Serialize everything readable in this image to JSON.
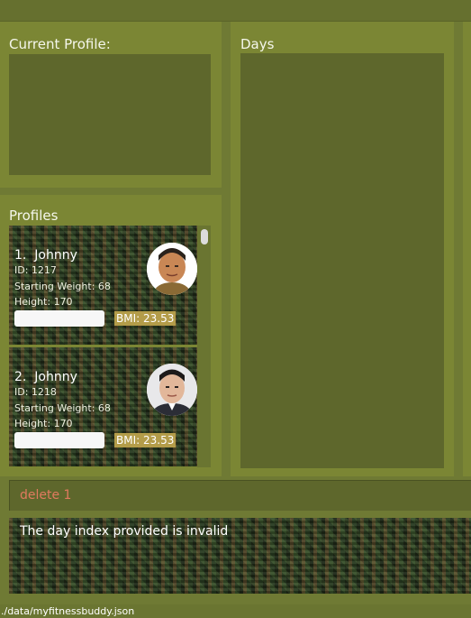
{
  "current_profile": {
    "title": "Current Profile:"
  },
  "days": {
    "title": "Days"
  },
  "profiles": {
    "title": "Profiles",
    "items": [
      {
        "index": "1.",
        "name": "Johnny",
        "id": "ID: 1217",
        "starting_weight": "Starting Weight: 68",
        "height": "Height: 170",
        "bmi": "BMI: 23.53"
      },
      {
        "index": "2.",
        "name": "Johnny",
        "id": "ID: 1218",
        "starting_weight": "Starting Weight: 68",
        "height": "Height: 170",
        "bmi": "BMI: 23.53"
      }
    ]
  },
  "command": {
    "value": "delete 1",
    "color": "#e07a5f"
  },
  "result": {
    "message": "The day index provided is invalid"
  },
  "status_bar": {
    "path": "./data/myfitnessbuddy.json"
  },
  "colors": {
    "panel": "#7b8634",
    "inner": "#5e672c",
    "bmi_badge": "#b39c49",
    "background": "#6f7a34"
  }
}
